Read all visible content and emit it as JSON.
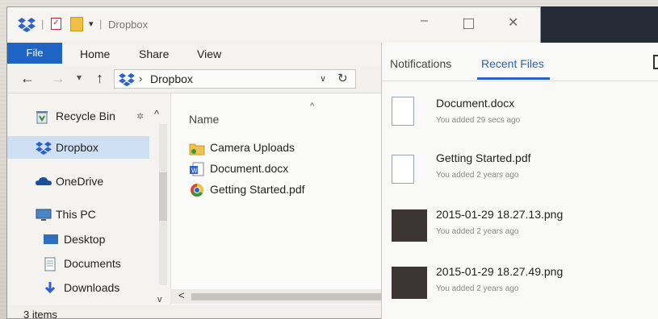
{
  "window": {
    "title": "Dropbox",
    "title_separator": "|",
    "quick_access_separator": "|",
    "quick_access_menu": "▾",
    "min_label": "–",
    "close_label": "✕"
  },
  "ribbon": {
    "tabs": [
      {
        "label": "File",
        "active": true
      },
      {
        "label": "Home"
      },
      {
        "label": "Share"
      },
      {
        "label": "View"
      }
    ]
  },
  "address": {
    "back": "←",
    "forward": "→",
    "recent": "▾",
    "up": "↑",
    "chevron": "›",
    "path": "Dropbox",
    "dropdown": "∨",
    "refresh": "↻"
  },
  "nav_pane": {
    "items": [
      {
        "label": "Recycle Bin",
        "icon": "recycle-bin-icon"
      },
      {
        "label": "Dropbox",
        "icon": "dropbox-icon",
        "selected": true
      },
      {
        "label": "OneDrive",
        "icon": "onedrive-icon"
      },
      {
        "label": "This PC",
        "icon": "computer-icon"
      },
      {
        "label": "Desktop",
        "icon": "desktop-icon"
      },
      {
        "label": "Documents",
        "icon": "documents-icon"
      },
      {
        "label": "Downloads",
        "icon": "downloads-icon"
      }
    ],
    "pin": "✲",
    "collapse": "^",
    "scroll_down": "v"
  },
  "file_pane": {
    "column_header": "Name",
    "sort_indicator": "^",
    "files": [
      {
        "name": "Camera Uploads",
        "icon": "folder-icon"
      },
      {
        "name": "Document.docx",
        "icon": "word-document-icon"
      },
      {
        "name": "Getting Started.pdf",
        "icon": "chrome-pdf-icon"
      }
    ],
    "scroll_left": "<"
  },
  "status": {
    "text": "3 items"
  },
  "panel": {
    "tabs": [
      {
        "label": "Notifications"
      },
      {
        "label": "Recent Files",
        "active": true
      }
    ],
    "recent": [
      {
        "name": "Document.docx",
        "meta": "You added 29 secs ago",
        "thumb": "document-thumbnail"
      },
      {
        "name": "Getting Started.pdf",
        "meta": "You added 2 years ago",
        "thumb": "pdf-thumbnail"
      },
      {
        "name": "2015-01-29 18.27.13.png",
        "meta": "You added 2 years ago",
        "thumb": "image-thumbnail"
      },
      {
        "name": "2015-01-29 18.27.49.png",
        "meta": "You added 2 years ago",
        "thumb": "image-thumbnail"
      }
    ]
  },
  "colors": {
    "file_tab": "#1d64c4",
    "selected_nav": "#cfe0f5",
    "active_panel_tab": "#2a5fbf",
    "dropbox_blue": "#2d62c8"
  }
}
